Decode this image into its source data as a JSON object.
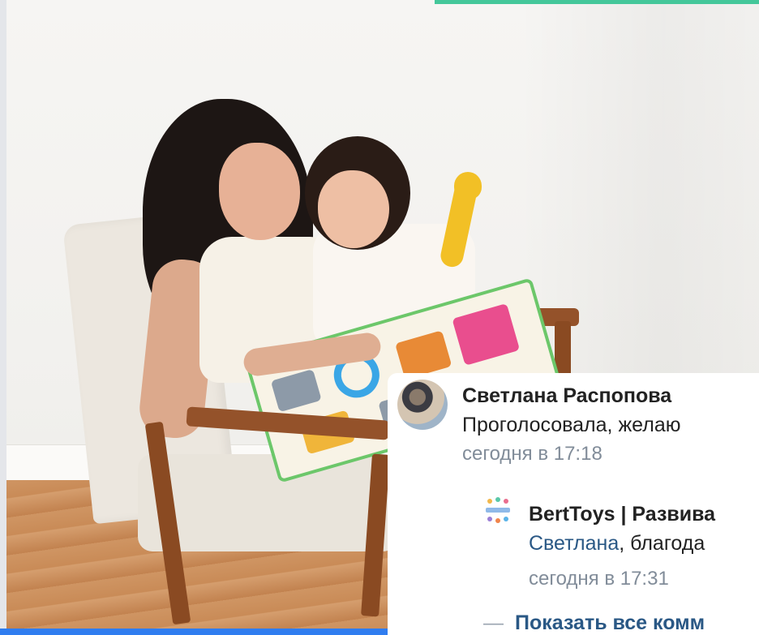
{
  "comment": {
    "author": "Светлана Распопова",
    "text": "Проголосовала, желаю",
    "time": "сегодня в 17:18"
  },
  "reply": {
    "author": "BertToys | Развива",
    "mention": "Светлана",
    "text": ", благода",
    "time": "сегодня в 17:31"
  },
  "show_all": {
    "label": "Показать все комм"
  },
  "colors": {
    "link": "#2a5885",
    "meta": "#818c99",
    "top_accent": "#44c79a",
    "bottom_accent": "#2f7df0"
  }
}
